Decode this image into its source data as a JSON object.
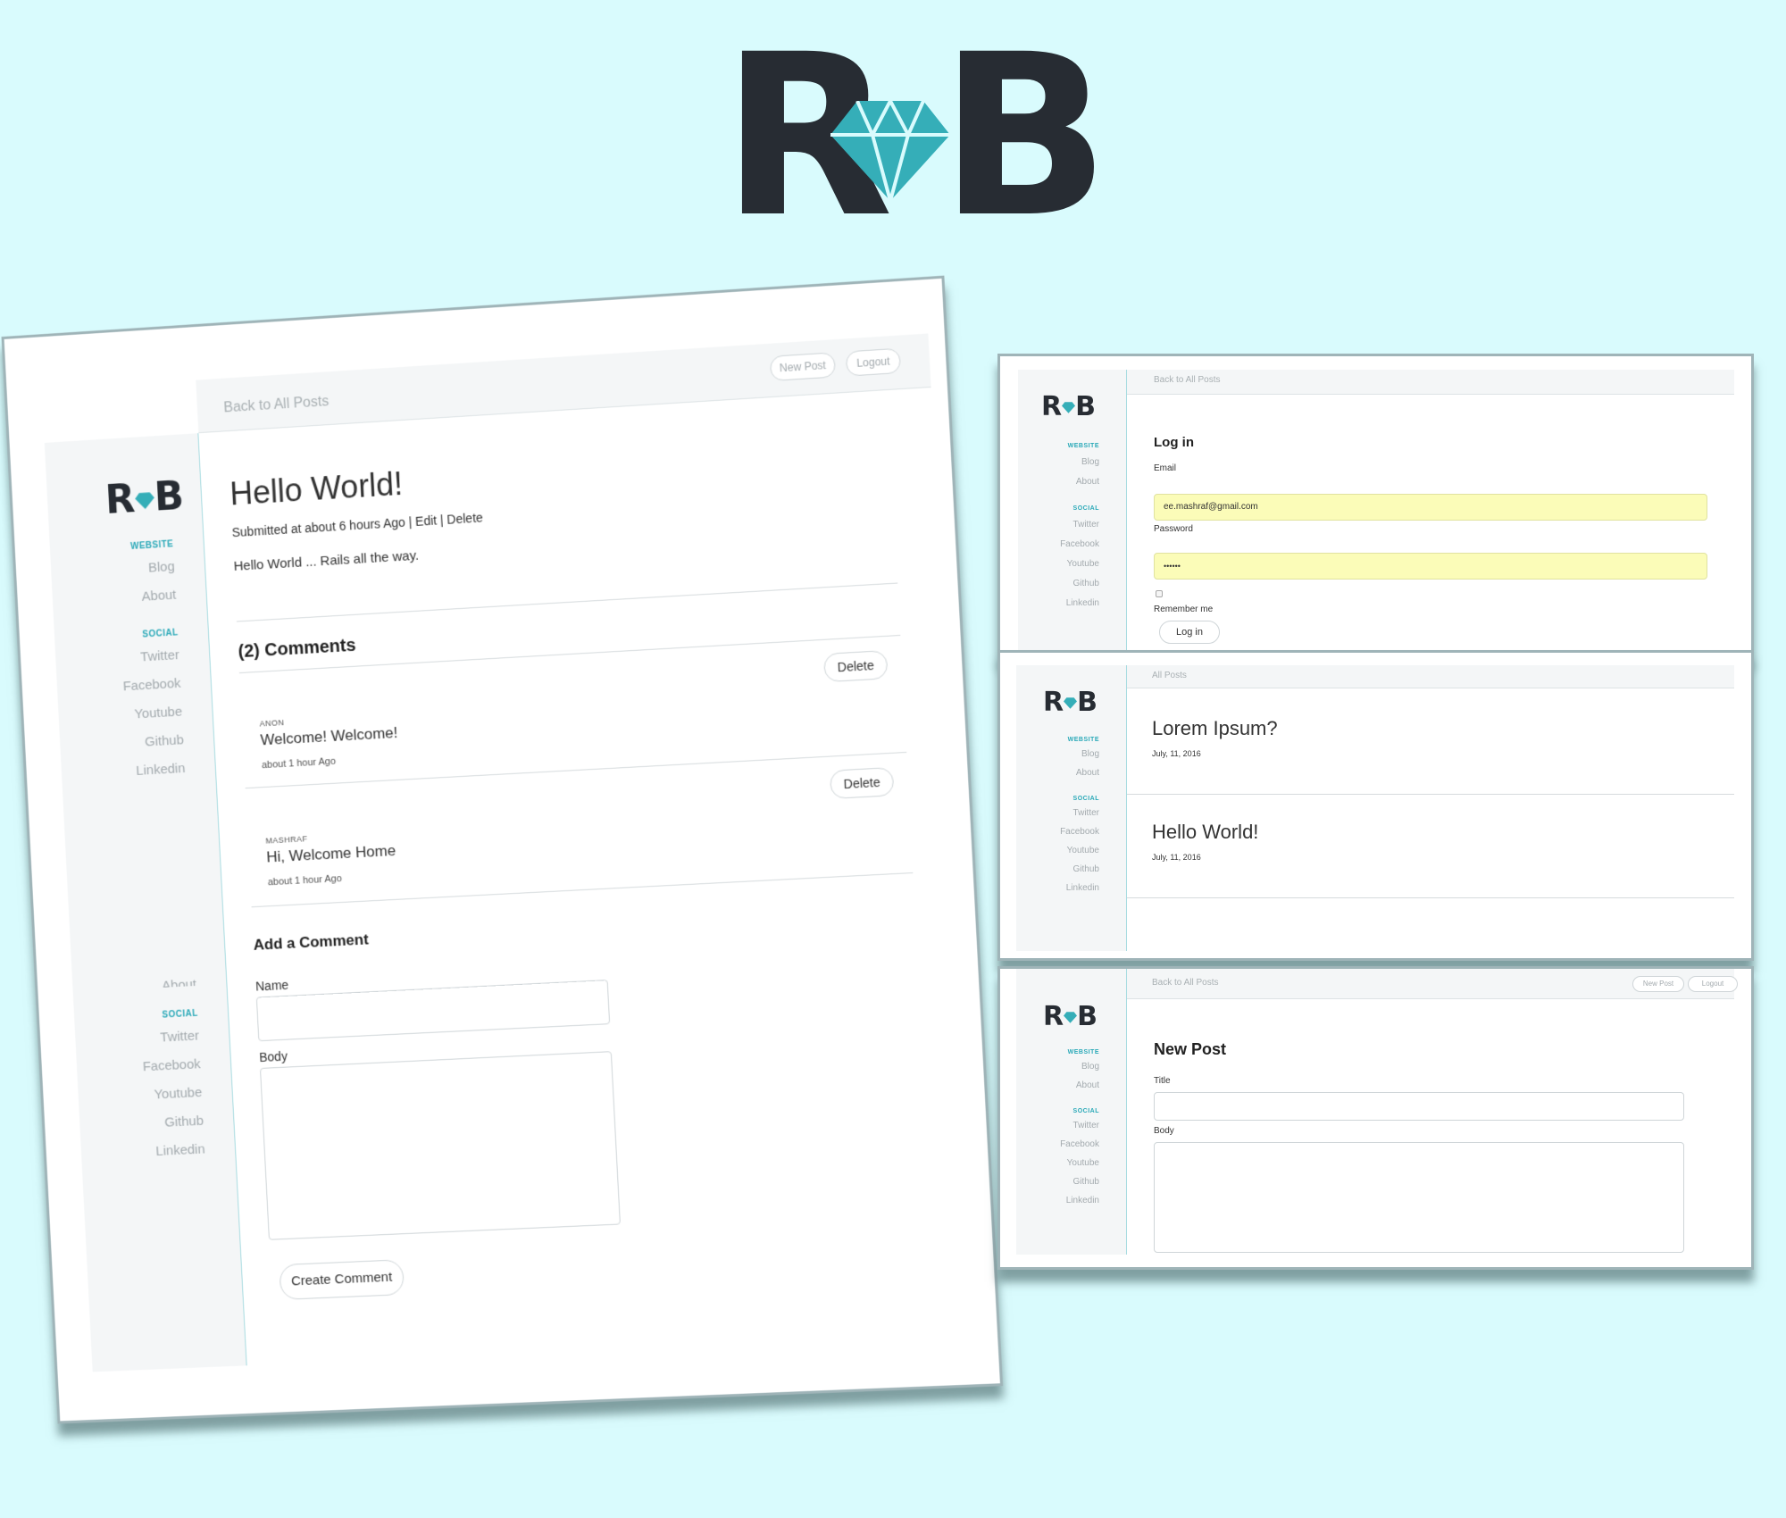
{
  "brand": {
    "logo_text": "R B",
    "diamond_color": "#35aeb8",
    "text_color": "#272c33",
    "accent_color": "#2aa9b8",
    "background_color": "#d9fbfd"
  },
  "sidebar": {
    "website_heading": "WEBSITE",
    "social_heading": "SOCIAL",
    "links_website": [
      "Blog",
      "About"
    ],
    "links_social": [
      "Twitter",
      "Facebook",
      "Youtube",
      "Github",
      "Linkedin"
    ],
    "artifact_about": "About",
    "artifact_social_heading": "SOCIAL"
  },
  "post_view": {
    "back_link": "Back to All Posts",
    "new_post_button": "New Post",
    "logout_button": "Logout",
    "title": "Hello World!",
    "meta": "Submitted at about 6 hours Ago",
    "separator": "|",
    "edit_link": "Edit",
    "delete_link": "Delete",
    "body_text": "Hello World ... Rails all the way.",
    "comments_heading": "(2) Comments",
    "comments": [
      {
        "author": "ANON",
        "text": "Welcome! Welcome!",
        "time": "about 1 hour Ago",
        "delete_label": "Delete"
      },
      {
        "author": "MASHRAF",
        "text": "Hi, Welcome Home",
        "time": "about 1 hour Ago",
        "delete_label": "Delete"
      }
    ],
    "add_comment_heading": "Add a Comment",
    "name_label": "Name",
    "body_label": "Body",
    "create_comment_button": "Create Comment"
  },
  "login_view": {
    "back_link": "Back to All Posts",
    "heading": "Log in",
    "email_label": "Email",
    "email_value": "ee.mashraf@gmail.com",
    "password_label": "Password",
    "password_value": "••••••",
    "remember_label": "Remember me",
    "submit_button": "Log in",
    "autofill_color": "#fbfcb8"
  },
  "posts_view": {
    "crumb": "All Posts",
    "posts": [
      {
        "title": "Lorem Ipsum?",
        "date": "July, 11, 2016"
      },
      {
        "title": "Hello World!",
        "date": "July, 11, 2016"
      }
    ]
  },
  "new_post_view": {
    "back_link": "Back to All Posts",
    "new_post_button": "New Post",
    "logout_button": "Logout",
    "heading": "New Post",
    "title_label": "Title",
    "body_label": "Body"
  }
}
